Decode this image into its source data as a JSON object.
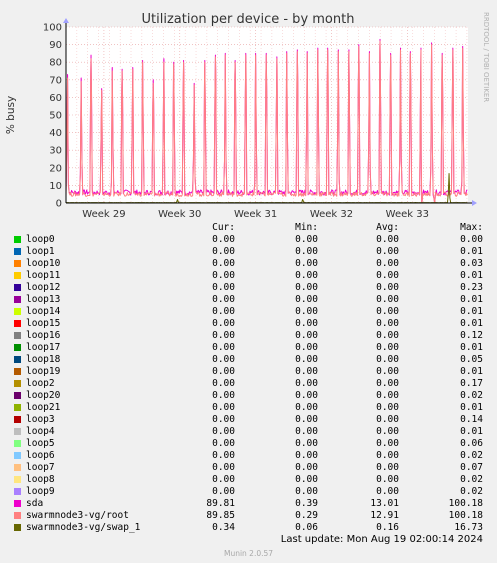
{
  "watermark": "RRDTOOL / TOBI OETIKER",
  "footer": {
    "last_update": "Last update: Mon Aug 19 02:00:14 2024",
    "version": "Munin 2.0.57"
  },
  "legend_headers": {
    "cur": "Cur:",
    "min": "Min:",
    "avg": "Avg:",
    "max": "Max:"
  },
  "legend": [
    {
      "name": "loop0",
      "color": "#00cc00",
      "cur": "0.00",
      "min": "0.00",
      "avg": "0.00",
      "max": "0.00"
    },
    {
      "name": "loop1",
      "color": "#0066b3",
      "cur": "0.00",
      "min": "0.00",
      "avg": "0.00",
      "max": "0.01"
    },
    {
      "name": "loop10",
      "color": "#ff8000",
      "cur": "0.00",
      "min": "0.00",
      "avg": "0.00",
      "max": "0.03"
    },
    {
      "name": "loop11",
      "color": "#ffcc00",
      "cur": "0.00",
      "min": "0.00",
      "avg": "0.00",
      "max": "0.01"
    },
    {
      "name": "loop12",
      "color": "#330099",
      "cur": "0.00",
      "min": "0.00",
      "avg": "0.00",
      "max": "0.23"
    },
    {
      "name": "loop13",
      "color": "#990099",
      "cur": "0.00",
      "min": "0.00",
      "avg": "0.00",
      "max": "0.01"
    },
    {
      "name": "loop14",
      "color": "#ccff00",
      "cur": "0.00",
      "min": "0.00",
      "avg": "0.00",
      "max": "0.01"
    },
    {
      "name": "loop15",
      "color": "#ff0000",
      "cur": "0.00",
      "min": "0.00",
      "avg": "0.00",
      "max": "0.01"
    },
    {
      "name": "loop16",
      "color": "#808080",
      "cur": "0.00",
      "min": "0.00",
      "avg": "0.00",
      "max": "0.12"
    },
    {
      "name": "loop17",
      "color": "#008f00",
      "cur": "0.00",
      "min": "0.00",
      "avg": "0.00",
      "max": "0.01"
    },
    {
      "name": "loop18",
      "color": "#00487d",
      "cur": "0.00",
      "min": "0.00",
      "avg": "0.00",
      "max": "0.05"
    },
    {
      "name": "loop19",
      "color": "#b35a00",
      "cur": "0.00",
      "min": "0.00",
      "avg": "0.00",
      "max": "0.01"
    },
    {
      "name": "loop2",
      "color": "#b38f00",
      "cur": "0.00",
      "min": "0.00",
      "avg": "0.00",
      "max": "0.17"
    },
    {
      "name": "loop20",
      "color": "#6b006b",
      "cur": "0.00",
      "min": "0.00",
      "avg": "0.00",
      "max": "0.02"
    },
    {
      "name": "loop21",
      "color": "#8fb300",
      "cur": "0.00",
      "min": "0.00",
      "avg": "0.00",
      "max": "0.01"
    },
    {
      "name": "loop3",
      "color": "#b30000",
      "cur": "0.00",
      "min": "0.00",
      "avg": "0.00",
      "max": "0.14"
    },
    {
      "name": "loop4",
      "color": "#bebebe",
      "cur": "0.00",
      "min": "0.00",
      "avg": "0.00",
      "max": "0.01"
    },
    {
      "name": "loop5",
      "color": "#80ff80",
      "cur": "0.00",
      "min": "0.00",
      "avg": "0.00",
      "max": "0.06"
    },
    {
      "name": "loop6",
      "color": "#80c9ff",
      "cur": "0.00",
      "min": "0.00",
      "avg": "0.00",
      "max": "0.02"
    },
    {
      "name": "loop7",
      "color": "#ffc080",
      "cur": "0.00",
      "min": "0.00",
      "avg": "0.00",
      "max": "0.07"
    },
    {
      "name": "loop8",
      "color": "#ffe680",
      "cur": "0.00",
      "min": "0.00",
      "avg": "0.00",
      "max": "0.02"
    },
    {
      "name": "loop9",
      "color": "#aa80ff",
      "cur": "0.00",
      "min": "0.00",
      "avg": "0.00",
      "max": "0.02"
    },
    {
      "name": "sda",
      "color": "#ee00cc",
      "cur": "89.81",
      "min": "0.39",
      "avg": "13.01",
      "max": "100.18"
    },
    {
      "name": "swarmnode3-vg/root",
      "color": "#ff8080",
      "cur": "89.85",
      "min": "0.29",
      "avg": "12.91",
      "max": "100.18"
    },
    {
      "name": "swarmnode3-vg/swap_1",
      "color": "#666600",
      "cur": "0.34",
      "min": "0.06",
      "avg": "0.16",
      "max": "16.73"
    }
  ],
  "chart_data": {
    "type": "line",
    "title": "Utilization per device - by month",
    "ylabel": "% busy",
    "xlabel": "",
    "ylim": [
      0,
      100
    ],
    "yticks": [
      0,
      10,
      20,
      30,
      40,
      50,
      60,
      70,
      80,
      90,
      100
    ],
    "xlim": [
      28.5,
      33.8
    ],
    "xticks": [
      {
        "label": "Week 29",
        "value": 29
      },
      {
        "label": "Week 30",
        "value": 30
      },
      {
        "label": "Week 31",
        "value": 31
      },
      {
        "label": "Week 32",
        "value": 32
      },
      {
        "label": "Week 33",
        "value": 33
      }
    ],
    "grid": true,
    "series": [
      {
        "name": "sda",
        "color": "#ee00cc",
        "baseline": 6,
        "peaks": [
          [
            28.52,
            73
          ],
          [
            28.7,
            71
          ],
          [
            28.83,
            84
          ],
          [
            28.97,
            65
          ],
          [
            29.11,
            77
          ],
          [
            29.24,
            76
          ],
          [
            29.38,
            77
          ],
          [
            29.51,
            81
          ],
          [
            29.65,
            70
          ],
          [
            29.79,
            82
          ],
          [
            29.92,
            80
          ],
          [
            30.05,
            81
          ],
          [
            30.19,
            68
          ],
          [
            30.33,
            81
          ],
          [
            30.47,
            84
          ],
          [
            30.6,
            85
          ],
          [
            30.73,
            81
          ],
          [
            30.87,
            85
          ],
          [
            31.0,
            85
          ],
          [
            31.14,
            85
          ],
          [
            31.28,
            83
          ],
          [
            31.41,
            86
          ],
          [
            31.55,
            87
          ],
          [
            31.68,
            86
          ],
          [
            31.82,
            88
          ],
          [
            31.95,
            88
          ],
          [
            32.09,
            87
          ],
          [
            32.23,
            87
          ],
          [
            32.36,
            90
          ],
          [
            32.5,
            86
          ],
          [
            32.64,
            93
          ],
          [
            32.78,
            85
          ],
          [
            32.91,
            88
          ],
          [
            33.04,
            86
          ],
          [
            33.18,
            88
          ],
          [
            33.32,
            91
          ],
          [
            33.46,
            85
          ],
          [
            33.6,
            88
          ],
          [
            33.73,
            89
          ]
        ],
        "dips": [
          [
            33.19,
            0
          ],
          [
            33.36,
            0
          ]
        ]
      },
      {
        "name": "swarmnode3-vg/root",
        "color": "#ff8080",
        "baseline": 5,
        "peaks": [
          [
            28.52,
            71
          ],
          [
            28.7,
            69
          ],
          [
            28.83,
            82
          ],
          [
            28.97,
            64
          ],
          [
            29.11,
            75
          ],
          [
            29.24,
            75
          ],
          [
            29.38,
            76
          ],
          [
            29.51,
            80
          ],
          [
            29.65,
            68
          ],
          [
            29.79,
            80
          ],
          [
            29.92,
            79
          ],
          [
            30.05,
            80
          ],
          [
            30.19,
            67
          ],
          [
            30.33,
            80
          ],
          [
            30.47,
            83
          ],
          [
            30.6,
            84
          ],
          [
            30.73,
            80
          ],
          [
            30.87,
            84
          ],
          [
            31.0,
            84
          ],
          [
            31.14,
            84
          ],
          [
            31.28,
            82
          ],
          [
            31.41,
            85
          ],
          [
            31.55,
            86
          ],
          [
            31.68,
            85
          ],
          [
            31.82,
            87
          ],
          [
            31.95,
            87
          ],
          [
            32.09,
            86
          ],
          [
            32.23,
            86
          ],
          [
            32.36,
            89
          ],
          [
            32.5,
            85
          ],
          [
            32.64,
            92
          ],
          [
            32.78,
            84
          ],
          [
            32.91,
            87
          ],
          [
            33.04,
            85
          ],
          [
            33.18,
            87
          ],
          [
            33.32,
            90
          ],
          [
            33.46,
            84
          ],
          [
            33.6,
            87
          ],
          [
            33.73,
            88
          ]
        ],
        "dips": [
          [
            33.19,
            0
          ],
          [
            33.36,
            0
          ]
        ]
      },
      {
        "name": "swarmnode3-vg/swap_1",
        "color": "#666600",
        "baseline": 0.2,
        "peaks": [
          [
            29.97,
            2
          ],
          [
            31.62,
            2
          ],
          [
            33.55,
            16.73
          ]
        ],
        "dips": []
      }
    ]
  }
}
